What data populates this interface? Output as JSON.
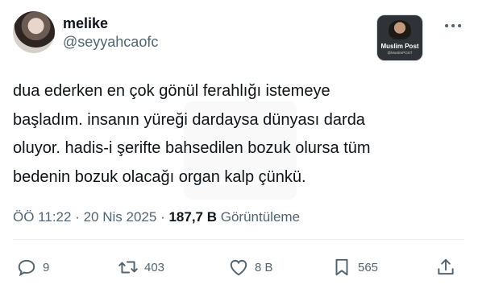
{
  "author": {
    "display_name": "melike",
    "handle": "@seyyahcaofc"
  },
  "badge": {
    "title": "Muslim Post",
    "subtitle": "@MuslimPOST"
  },
  "watermark": {
    "text": "@MuslimPOST"
  },
  "tweet": {
    "text": "dua ederken en çok gönül ferahlığı istemeye\nbaşladım. insanın yüreği dardaysa dünyası darda\noluyor. hadis-i şerifte bahsedilen bozuk olursa tüm\nbedenin bozuk olacağı organ kalp çünkü."
  },
  "meta": {
    "time": "ÖÖ 11:22",
    "separator1": "·",
    "date": "20 Nis 2025",
    "separator2": "·",
    "views_count": "187,7 B",
    "views_label": "Görüntüleme"
  },
  "actions": {
    "replies": "9",
    "reposts": "403",
    "likes": "8 B",
    "bookmarks": "565"
  },
  "colors": {
    "text": "#0f1419",
    "secondary": "#536471",
    "divider": "#eff3f4"
  },
  "icons": [
    "more-icon",
    "reply-icon",
    "repost-icon",
    "like-icon",
    "bookmark-icon",
    "share-icon"
  ]
}
